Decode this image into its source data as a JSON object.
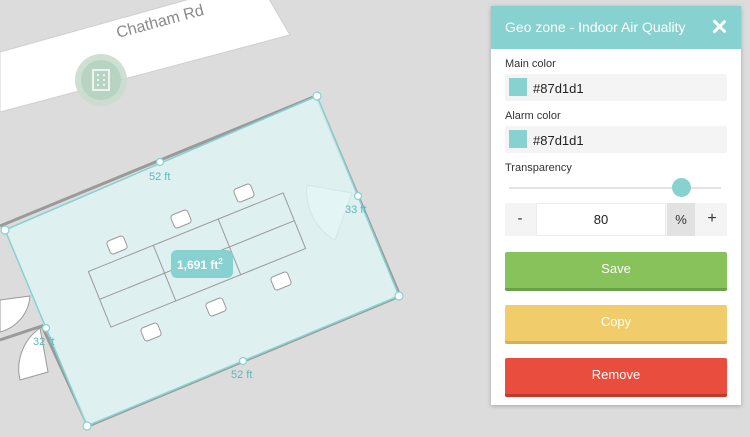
{
  "map": {
    "street_name": "Chatham Rd",
    "area_label": "1,691 ft",
    "area_unit_sup": "2",
    "dimensions": {
      "top": "52 ft",
      "right": "33 ft",
      "bottom": "52 ft",
      "left": "32 ft"
    },
    "zone_fill": "#dff3f3",
    "zone_stroke": "#87d1d1",
    "marker_icon": "building-icon"
  },
  "panel": {
    "title": "Geo zone - Indoor Air Quality",
    "close_icon": "close-icon",
    "main_color_label": "Main color",
    "main_color_value": "#87d1d1",
    "alarm_color_label": "Alarm color",
    "alarm_color_value": "#87d1d1",
    "transparency_label": "Transparency",
    "transparency_value": "80",
    "transparency_unit": "%",
    "minus_label": "-",
    "plus_label": "+",
    "save_label": "Save",
    "copy_label": "Copy",
    "remove_label": "Remove",
    "colors": {
      "header": "#87d1d1",
      "save": "#87c25b",
      "copy": "#f0cc6a",
      "remove": "#e84d3d"
    }
  }
}
